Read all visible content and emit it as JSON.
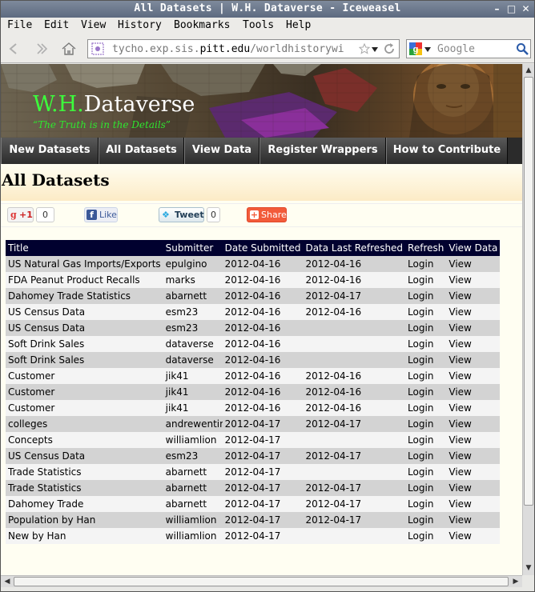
{
  "window": {
    "title": "All Datasets | W.H. Dataverse - Iceweasel"
  },
  "menu": [
    "File",
    "Edit",
    "View",
    "History",
    "Bookmarks",
    "Tools",
    "Help"
  ],
  "navbar": {
    "url_prefix": "tycho.exp.sis.",
    "url_domain": "pitt.edu",
    "url_suffix": "/worldhistorywi",
    "search_placeholder": "Google"
  },
  "site": {
    "brand_wh": "W.H.",
    "brand_dataverse": "Dataverse",
    "tagline": "“The Truth is in the Details”",
    "tabs": [
      "New Datasets",
      "All Datasets",
      "View Data",
      "Register Wrappers",
      "How to Contribute"
    ],
    "page_title": "All Datasets"
  },
  "social": {
    "gplus_label": "+1",
    "gplus_count": "0",
    "like_label": "Like",
    "tweet_label": "Tweet",
    "tweet_count": "0",
    "share_label": "Share"
  },
  "table": {
    "headers": [
      "Title",
      "Submitter",
      "Date Submitted",
      "Data Last Refreshed",
      "Refresh",
      "View Data"
    ],
    "rows": [
      [
        "US Natural Gas Imports/Exports",
        "epulgino",
        "2012-04-16",
        "2012-04-16",
        "Login",
        "View"
      ],
      [
        "FDA Peanut Product Recalls",
        "marks",
        "2012-04-16",
        "2012-04-16",
        "Login",
        "View"
      ],
      [
        "Dahomey Trade Statistics",
        "abarnett",
        "2012-04-16",
        "2012-04-17",
        "Login",
        "View"
      ],
      [
        "US Census Data",
        "esm23",
        "2012-04-16",
        "2012-04-16",
        "Login",
        "View"
      ],
      [
        "US Census Data",
        "esm23",
        "2012-04-16",
        "",
        "Login",
        "View"
      ],
      [
        "Soft Drink Sales",
        "dataverse",
        "2012-04-16",
        "",
        "Login",
        "View"
      ],
      [
        "Soft Drink Sales",
        "dataverse",
        "2012-04-16",
        "",
        "Login",
        "View"
      ],
      [
        "Customer",
        "jik41",
        "2012-04-16",
        "2012-04-16",
        "Login",
        "View"
      ],
      [
        "Customer",
        "jik41",
        "2012-04-16",
        "2012-04-16",
        "Login",
        "View"
      ],
      [
        "Customer",
        "jik41",
        "2012-04-16",
        "2012-04-16",
        "Login",
        "View"
      ],
      [
        "colleges",
        "andrewentin",
        "2012-04-17",
        "2012-04-17",
        "Login",
        "View"
      ],
      [
        "Concepts",
        "williamlion",
        "2012-04-17",
        "",
        "Login",
        "View"
      ],
      [
        "US Census Data",
        "esm23",
        "2012-04-17",
        "2012-04-17",
        "Login",
        "View"
      ],
      [
        "Trade Statistics",
        "abarnett",
        "2012-04-17",
        "",
        "Login",
        "View"
      ],
      [
        "Trade Statistics",
        "abarnett",
        "2012-04-17",
        "2012-04-17",
        "Login",
        "View"
      ],
      [
        "Dahomey Trade",
        "abarnett",
        "2012-04-17",
        "2012-04-17",
        "Login",
        "View"
      ],
      [
        "Population by Han",
        "williamlion",
        "2012-04-17",
        "2012-04-17",
        "Login",
        "View"
      ],
      [
        "New by Han",
        "williamlion",
        "2012-04-17",
        "",
        "Login",
        "View"
      ]
    ]
  }
}
